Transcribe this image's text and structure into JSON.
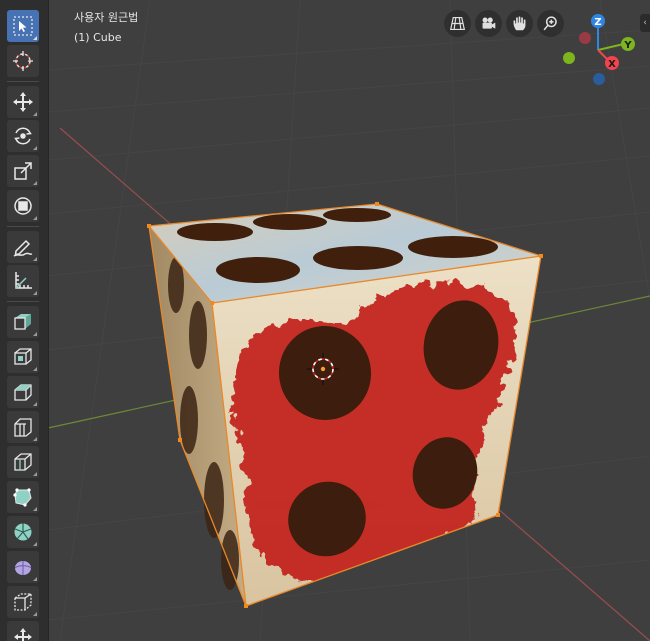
{
  "viewport": {
    "view_label": "사용자 원근법",
    "object_label": "(1) Cube"
  },
  "toolbar": {
    "tools": [
      {
        "name": "select-box-tool",
        "icon": "cursor-select-icon",
        "active": true
      },
      {
        "name": "cursor-tool",
        "icon": "3d-cursor-icon",
        "active": false
      },
      {
        "name": "move-tool",
        "icon": "move-icon",
        "active": false
      },
      {
        "name": "rotate-tool",
        "icon": "rotate-icon",
        "active": false
      },
      {
        "name": "scale-tool",
        "icon": "scale-icon",
        "active": false
      },
      {
        "name": "transform-tool",
        "icon": "transform-icon",
        "active": false
      },
      {
        "name": "annotate-tool",
        "icon": "annotate-pencil-icon",
        "active": false
      },
      {
        "name": "measure-tool",
        "icon": "ruler-icon",
        "active": false
      },
      {
        "name": "add-cube-tool",
        "icon": "add-cube-icon",
        "active": false
      },
      {
        "name": "extrude-tool",
        "icon": "extrude-icon",
        "active": false
      },
      {
        "name": "inset-faces-tool",
        "icon": "inset-faces-icon",
        "active": false
      },
      {
        "name": "bevel-tool",
        "icon": "bevel-icon",
        "active": false
      },
      {
        "name": "loop-cut-tool",
        "icon": "loop-cut-icon",
        "active": false
      },
      {
        "name": "knife-tool",
        "icon": "knife-icon",
        "active": false
      },
      {
        "name": "poly-build-tool",
        "icon": "poly-build-icon",
        "active": false
      },
      {
        "name": "spin-tool",
        "icon": "spin-icon",
        "active": false
      },
      {
        "name": "smooth-tool",
        "icon": "smooth-icon",
        "active": false
      },
      {
        "name": "shear-tool",
        "icon": "shear-icon",
        "active": false
      },
      {
        "name": "rip-tool",
        "icon": "rip-icon",
        "active": false
      }
    ]
  },
  "nav_buttons": [
    {
      "name": "toggle-ortho-button",
      "icon": "grid-perspective-icon"
    },
    {
      "name": "camera-view-button",
      "icon": "camera-icon"
    },
    {
      "name": "pan-view-button",
      "icon": "hand-icon"
    },
    {
      "name": "zoom-view-button",
      "icon": "zoom-icon"
    }
  ],
  "gizmo": {
    "z_label": "Z",
    "y_label": "Y",
    "x_label": "X",
    "colors": {
      "x": "#f0454e",
      "y": "#7cb51d",
      "z": "#2f85e3"
    }
  },
  "cube": {
    "edge_color": "#e8882a",
    "dot_color": "#3b1d0c",
    "face_color": "#e8d8b8",
    "paint_color": "#c0221a"
  }
}
